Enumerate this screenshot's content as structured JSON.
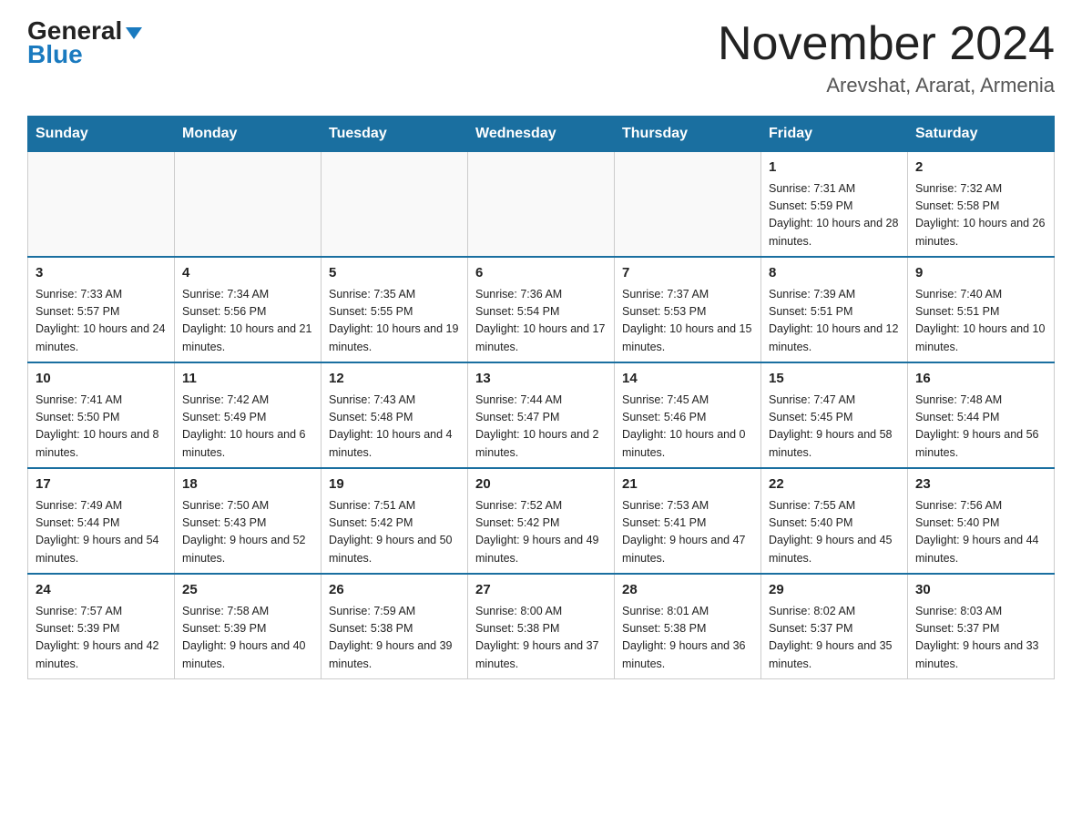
{
  "header": {
    "logo_text_general": "General",
    "logo_text_blue": "Blue",
    "month_title": "November 2024",
    "location": "Arevshat, Ararat, Armenia"
  },
  "days_of_week": [
    "Sunday",
    "Monday",
    "Tuesday",
    "Wednesday",
    "Thursday",
    "Friday",
    "Saturday"
  ],
  "weeks": [
    [
      {
        "day": "",
        "info": ""
      },
      {
        "day": "",
        "info": ""
      },
      {
        "day": "",
        "info": ""
      },
      {
        "day": "",
        "info": ""
      },
      {
        "day": "",
        "info": ""
      },
      {
        "day": "1",
        "info": "Sunrise: 7:31 AM\nSunset: 5:59 PM\nDaylight: 10 hours and 28 minutes."
      },
      {
        "day": "2",
        "info": "Sunrise: 7:32 AM\nSunset: 5:58 PM\nDaylight: 10 hours and 26 minutes."
      }
    ],
    [
      {
        "day": "3",
        "info": "Sunrise: 7:33 AM\nSunset: 5:57 PM\nDaylight: 10 hours and 24 minutes."
      },
      {
        "day": "4",
        "info": "Sunrise: 7:34 AM\nSunset: 5:56 PM\nDaylight: 10 hours and 21 minutes."
      },
      {
        "day": "5",
        "info": "Sunrise: 7:35 AM\nSunset: 5:55 PM\nDaylight: 10 hours and 19 minutes."
      },
      {
        "day": "6",
        "info": "Sunrise: 7:36 AM\nSunset: 5:54 PM\nDaylight: 10 hours and 17 minutes."
      },
      {
        "day": "7",
        "info": "Sunrise: 7:37 AM\nSunset: 5:53 PM\nDaylight: 10 hours and 15 minutes."
      },
      {
        "day": "8",
        "info": "Sunrise: 7:39 AM\nSunset: 5:51 PM\nDaylight: 10 hours and 12 minutes."
      },
      {
        "day": "9",
        "info": "Sunrise: 7:40 AM\nSunset: 5:51 PM\nDaylight: 10 hours and 10 minutes."
      }
    ],
    [
      {
        "day": "10",
        "info": "Sunrise: 7:41 AM\nSunset: 5:50 PM\nDaylight: 10 hours and 8 minutes."
      },
      {
        "day": "11",
        "info": "Sunrise: 7:42 AM\nSunset: 5:49 PM\nDaylight: 10 hours and 6 minutes."
      },
      {
        "day": "12",
        "info": "Sunrise: 7:43 AM\nSunset: 5:48 PM\nDaylight: 10 hours and 4 minutes."
      },
      {
        "day": "13",
        "info": "Sunrise: 7:44 AM\nSunset: 5:47 PM\nDaylight: 10 hours and 2 minutes."
      },
      {
        "day": "14",
        "info": "Sunrise: 7:45 AM\nSunset: 5:46 PM\nDaylight: 10 hours and 0 minutes."
      },
      {
        "day": "15",
        "info": "Sunrise: 7:47 AM\nSunset: 5:45 PM\nDaylight: 9 hours and 58 minutes."
      },
      {
        "day": "16",
        "info": "Sunrise: 7:48 AM\nSunset: 5:44 PM\nDaylight: 9 hours and 56 minutes."
      }
    ],
    [
      {
        "day": "17",
        "info": "Sunrise: 7:49 AM\nSunset: 5:44 PM\nDaylight: 9 hours and 54 minutes."
      },
      {
        "day": "18",
        "info": "Sunrise: 7:50 AM\nSunset: 5:43 PM\nDaylight: 9 hours and 52 minutes."
      },
      {
        "day": "19",
        "info": "Sunrise: 7:51 AM\nSunset: 5:42 PM\nDaylight: 9 hours and 50 minutes."
      },
      {
        "day": "20",
        "info": "Sunrise: 7:52 AM\nSunset: 5:42 PM\nDaylight: 9 hours and 49 minutes."
      },
      {
        "day": "21",
        "info": "Sunrise: 7:53 AM\nSunset: 5:41 PM\nDaylight: 9 hours and 47 minutes."
      },
      {
        "day": "22",
        "info": "Sunrise: 7:55 AM\nSunset: 5:40 PM\nDaylight: 9 hours and 45 minutes."
      },
      {
        "day": "23",
        "info": "Sunrise: 7:56 AM\nSunset: 5:40 PM\nDaylight: 9 hours and 44 minutes."
      }
    ],
    [
      {
        "day": "24",
        "info": "Sunrise: 7:57 AM\nSunset: 5:39 PM\nDaylight: 9 hours and 42 minutes."
      },
      {
        "day": "25",
        "info": "Sunrise: 7:58 AM\nSunset: 5:39 PM\nDaylight: 9 hours and 40 minutes."
      },
      {
        "day": "26",
        "info": "Sunrise: 7:59 AM\nSunset: 5:38 PM\nDaylight: 9 hours and 39 minutes."
      },
      {
        "day": "27",
        "info": "Sunrise: 8:00 AM\nSunset: 5:38 PM\nDaylight: 9 hours and 37 minutes."
      },
      {
        "day": "28",
        "info": "Sunrise: 8:01 AM\nSunset: 5:38 PM\nDaylight: 9 hours and 36 minutes."
      },
      {
        "day": "29",
        "info": "Sunrise: 8:02 AM\nSunset: 5:37 PM\nDaylight: 9 hours and 35 minutes."
      },
      {
        "day": "30",
        "info": "Sunrise: 8:03 AM\nSunset: 5:37 PM\nDaylight: 9 hours and 33 minutes."
      }
    ]
  ]
}
